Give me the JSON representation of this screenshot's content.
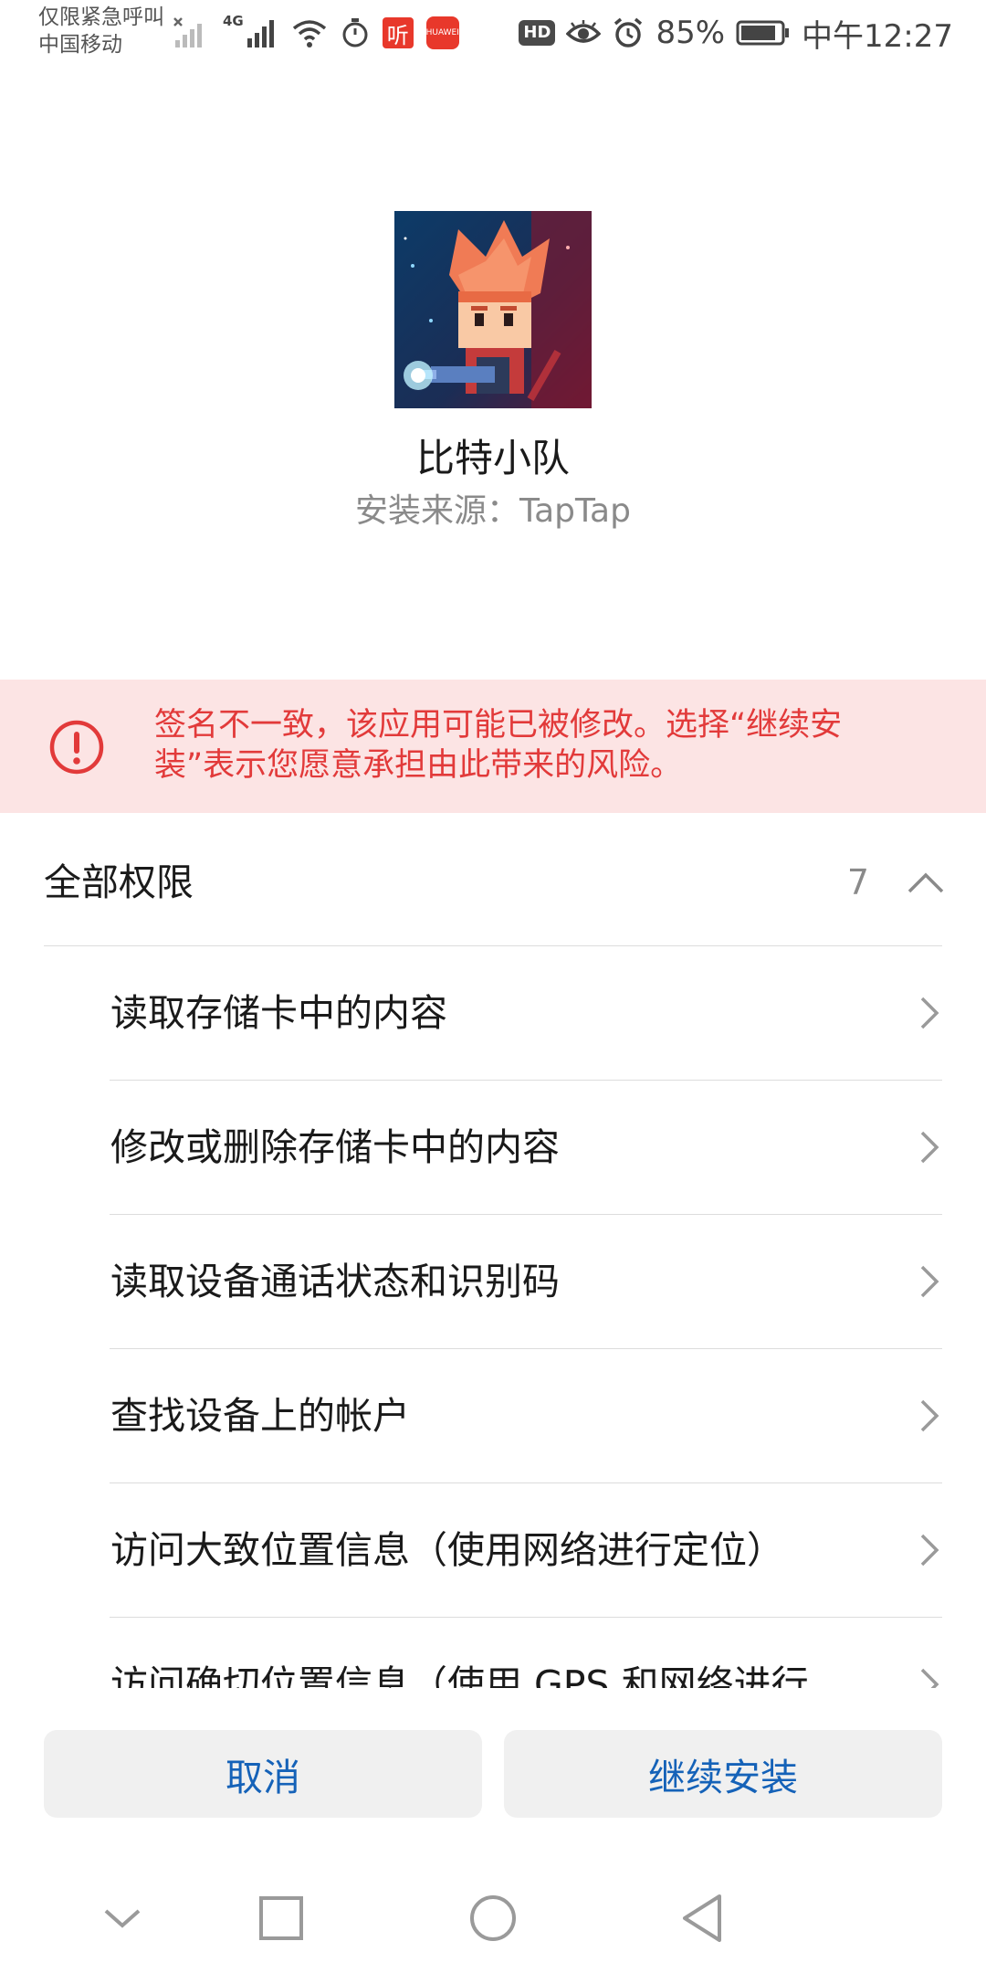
{
  "status_bar": {
    "carrier_line1": "仅限紧急呼叫",
    "carrier_line2": "中国移动",
    "network_label": "4G",
    "ting_label": "听",
    "huawei_label": "HUAWEI",
    "hd_label": "HD",
    "battery": "85%",
    "time": "中午12:27"
  },
  "app": {
    "name": "比特小队",
    "install_source": "安装来源：TapTap",
    "icon": "game-character-icon"
  },
  "warning": {
    "text": "签名不一致，该应用可能已被修改。选择“继续安装”表示您愿意承担由此带来的风险。",
    "color": "#e23a3a",
    "background": "#fce4e4"
  },
  "permissions": {
    "title": "全部权限",
    "count": "7",
    "items": [
      {
        "label": "读取存储卡中的内容"
      },
      {
        "label": "修改或删除存储卡中的内容"
      },
      {
        "label": "读取设备通话状态和识别码"
      },
      {
        "label": "查找设备上的帐户"
      },
      {
        "label": "访问大致位置信息（使用网络进行定位）"
      },
      {
        "label": "访问确切位置信息（使用 GPS 和网络进行"
      }
    ]
  },
  "buttons": {
    "cancel": "取消",
    "continue": "继续安装",
    "accent": "#1562b8"
  },
  "nav": {
    "icons": [
      "collapse-icon",
      "recents-icon",
      "home-icon",
      "back-icon"
    ]
  }
}
